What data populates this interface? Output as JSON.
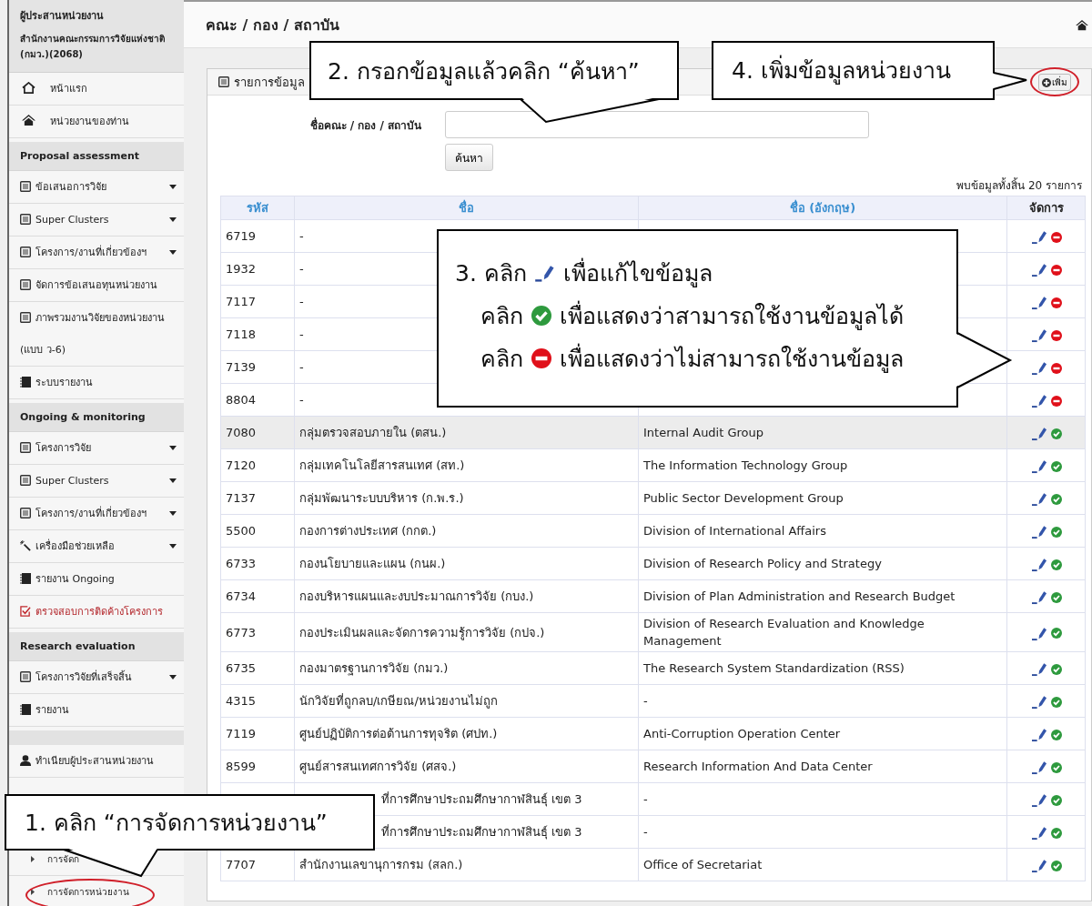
{
  "sidebar": {
    "user": {
      "role": "ผู้ประสานหน่วยงาน",
      "org": "สำนักงานคณะกรรมการวิจัยแห่งชาติ (กมว.)(2068)"
    },
    "sections": [
      {
        "items": [
          {
            "kind": "home",
            "label": "หน้าแรก"
          },
          {
            "kind": "unit",
            "label": "หน่วยงานของท่าน"
          }
        ]
      },
      {
        "title": "Proposal assessment",
        "items": [
          {
            "kind": "menu",
            "label": "ข้อเสนอการวิจัย",
            "has_submenu": true
          },
          {
            "kind": "menu",
            "label": "Super Clusters",
            "has_submenu": true
          },
          {
            "kind": "menu",
            "label": "โครงการ/งานที่เกี่ยวข้องฯ",
            "has_submenu": true
          },
          {
            "kind": "menu",
            "label": "จัดการข้อเสนอทุนหน่วยงาน",
            "has_submenu": false
          },
          {
            "kind": "menu",
            "label": "ภาพรวมงานวิจัยของหน่วยงาน (แบบ ว-6)",
            "has_submenu": false
          },
          {
            "kind": "report",
            "label": "ระบบรายงาน",
            "has_submenu": false
          }
        ]
      },
      {
        "title": "Ongoing & monitoring",
        "items": [
          {
            "kind": "menu",
            "label": "โครงการวิจัย",
            "has_submenu": true
          },
          {
            "kind": "menu",
            "label": "Super Clusters",
            "has_submenu": true
          },
          {
            "kind": "menu",
            "label": "โครงการ/งานที่เกี่ยวข้องฯ",
            "has_submenu": true
          },
          {
            "kind": "tools",
            "label": "เครื่องมือช่วยเหลือ",
            "has_submenu": true
          },
          {
            "kind": "report",
            "label": "รายงาน Ongoing",
            "has_submenu": false
          },
          {
            "kind": "alert",
            "label": "ตรวจสอบการติดค้างโครงการ",
            "has_submenu": false
          }
        ]
      },
      {
        "title": "Research evaluation",
        "items": [
          {
            "kind": "menu",
            "label": "โครงการวิจัยที่เสร็จสิ้น",
            "has_submenu": true
          },
          {
            "kind": "report",
            "label": "รายงาน",
            "has_submenu": false
          }
        ]
      },
      {
        "items": [
          {
            "kind": "directory",
            "label": "ทำเนียบผู้ประสานหน่วยงาน",
            "has_submenu": false
          },
          {
            "kind": "group",
            "children": [
              {
                "label": "การจัดก",
                "circled": false
              },
              {
                "label": "การจัดการหน่วยงาน",
                "circled": true
              }
            ]
          }
        ]
      }
    ]
  },
  "header": {
    "title": "คณะ / กอง / สถาบัน"
  },
  "panel": {
    "title": "รายการข้อมูล",
    "add_button": {
      "label": "เพิ่ม",
      "circled": true
    },
    "search": {
      "label": "ชื่อคณะ / กอง / สถาบัน",
      "button": "ค้นหา"
    },
    "count": "พบข้อมูลทั้งสิ้น 20 รายการ",
    "table": {
      "columns": [
        "รหัส",
        "ชื่อ",
        "ชื่อ (อังกฤษ)",
        "จัดการ"
      ],
      "rows": [
        {
          "code": "6719",
          "name": "-",
          "enabled": false,
          "highlighted": false
        },
        {
          "code": "1932",
          "name": "-",
          "enabled": false,
          "highlighted": false
        },
        {
          "code": "7117",
          "name": "-",
          "enabled": false,
          "highlighted": false
        },
        {
          "code": "7118",
          "name": "-",
          "enabled": false,
          "highlighted": false
        },
        {
          "code": "7139",
          "name": "-",
          "enabled": false,
          "highlighted": false
        },
        {
          "code": "8804",
          "name": "-",
          "enabled": false,
          "highlighted": false
        },
        {
          "code": "7080",
          "name": "กลุ่มตรวจสอบภายใน (ตสน.)",
          "name_en": "Internal Audit Group",
          "enabled": true,
          "highlighted": true
        },
        {
          "code": "7120",
          "name": "กลุ่มเทคโนโลยีสารสนเทศ (สท.)",
          "name_en": "The Information Technology Group",
          "enabled": true,
          "highlighted": false
        },
        {
          "code": "7137",
          "name": "กลุ่มพัฒนาระบบบริหาร (ก.พ.ร.)",
          "name_en": "Public Sector Development Group",
          "enabled": true,
          "highlighted": false
        },
        {
          "code": "5500",
          "name": "กองการต่างประเทศ (กกต.)",
          "name_en": "Division of International Affairs",
          "enabled": true,
          "highlighted": false
        },
        {
          "code": "6733",
          "name": "กองนโยบายและแผน (กนผ.)",
          "name_en": "Division of Research Policy and Strategy",
          "enabled": true,
          "highlighted": false
        },
        {
          "code": "6734",
          "name": "กองบริหารแผนและงบประมาณการวิจัย (กบง.)",
          "name_en": "Division of Plan Administration and Research Budget",
          "enabled": true,
          "highlighted": false
        },
        {
          "code": "6773",
          "name": "กองประเมินผลและจัดการความรู้การวิจัย (กปจ.)",
          "name_en": "Division of Research Evaluation and Knowledge Management",
          "enabled": true,
          "highlighted": false
        },
        {
          "code": "6735",
          "name": "กองมาตรฐานการวิจัย (กมว.)",
          "name_en": "The Research System Standardization (RSS)",
          "enabled": true,
          "highlighted": false
        },
        {
          "code": "4315",
          "name": "นักวิจัยที่ถูกลบ/เกษียณ/หน่วยงานไม่ถูก",
          "name_en": "-",
          "enabled": true,
          "highlighted": false
        },
        {
          "code": "7119",
          "name": "ศูนย์ปฏิบัติการต่อต้านการทุจริต (ศปท.)",
          "name_en": "Anti-Corruption Operation Center",
          "enabled": true,
          "highlighted": false
        },
        {
          "code": "8599",
          "name": "ศูนย์สารสนเทศการวิจัย (ศสจ.)",
          "name_en": "Research Information And Data Center",
          "enabled": true,
          "highlighted": false
        },
        {
          "name": "ที่การศึกษาประถมศึกษากาฬสินธุ์ เขต 3",
          "name_en": "-",
          "enabled": true,
          "highlighted": false
        },
        {
          "name": "ที่การศึกษาประถมศึกษากาฬสินธุ์ เขต 3",
          "name_en": "-",
          "enabled": true,
          "highlighted": false
        },
        {
          "code": "7707",
          "name": "สำนักงานเลขานุการกรม (สลก.)",
          "name_en": "Office of Secretariat",
          "enabled": true,
          "highlighted": false
        }
      ]
    }
  },
  "callouts": [
    {
      "kind": "text",
      "text": "2. กรอกข้อมูลแล้วคลิก “ค้นหา”"
    },
    {
      "kind": "text",
      "text": "4. เพิ่มข้อมูลหน่วยงาน"
    },
    {
      "kind": "lines",
      "lines": [
        {
          "text": "3. คลิก",
          "kind": "edit",
          "after": "เพื่อแก้ไขข้อมูล"
        },
        {
          "text": "คลิก",
          "kind": "enable",
          "after": "เพื่อแสดงว่าสามารถใช้งานข้อมูลได้"
        },
        {
          "text": "คลิก",
          "kind": "disable",
          "after": "เพื่อแสดงว่าไม่สามารถใช้งานข้อมูล"
        }
      ]
    },
    {
      "kind": "text",
      "text": "1. คลิก “การจัดการหน่วยงาน”"
    }
  ]
}
